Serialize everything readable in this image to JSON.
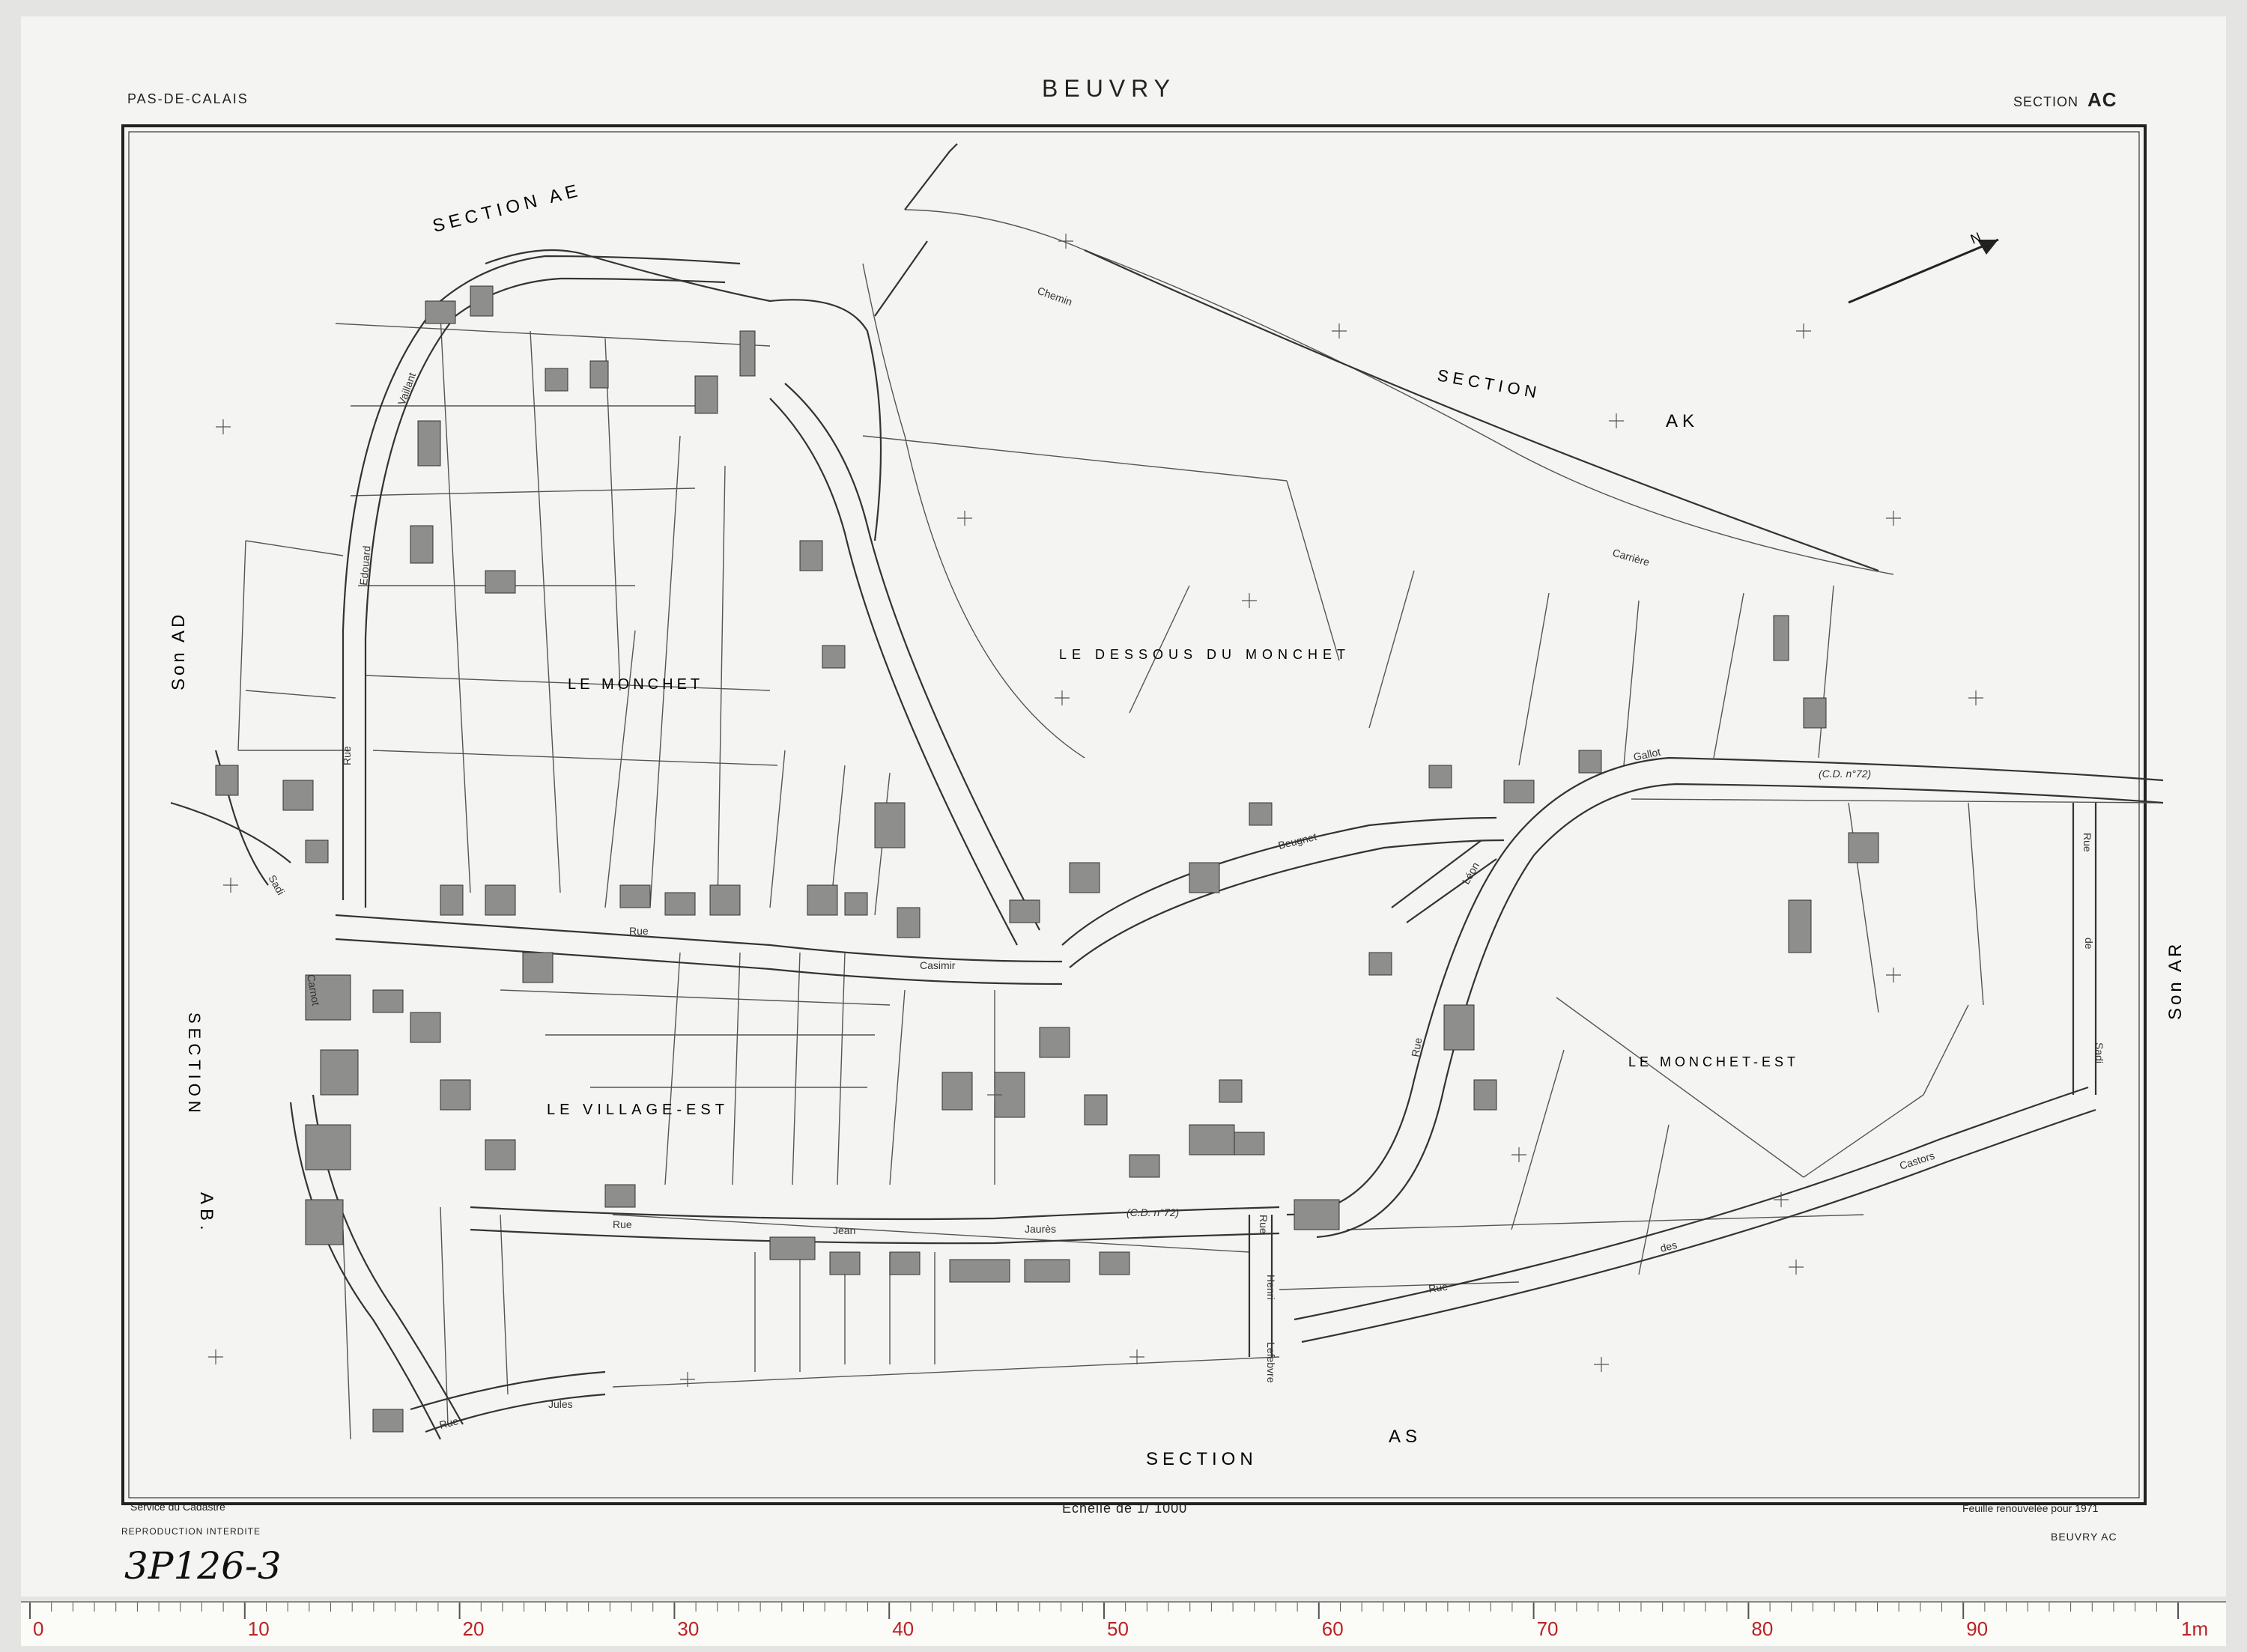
{
  "header": {
    "department": "PAS-DE-CALAIS",
    "commune": "BEUVRY",
    "section_word": "SECTION",
    "section_code": "AC"
  },
  "footer": {
    "service": "Service du Cadastre",
    "reproduction": "REPRODUCTION INTERDITE",
    "scale": "Echelle de 1/ 1000",
    "renewal": "Feuille renouvelée pour 1971",
    "sheet_ref": "BEUVRY AC",
    "archive_code": "3P126-3"
  },
  "map": {
    "neighbor_sections": {
      "ae": "SECTION AE",
      "ak_a": "SECTION",
      "ak_b": "AK",
      "ad": "Son AD",
      "ab_a": "SECTION",
      "ab_b": "AB.",
      "as_a": "SECTION",
      "as_b": "AS",
      "ar": "Son AR"
    },
    "localities": [
      "LE MONCHET",
      "LE DESSOUS DU MONCHET",
      "LE VILLAGE-EST",
      "LE MONCHET-EST"
    ],
    "road_labels": {
      "cd72_east": "(C.D. n°72)",
      "cd72_south": "(C.D. n°72)",
      "rue_casimir": "Casimir",
      "rue_jean_jaures_a": "Rue",
      "rue_jean_jaures_b": "Jean",
      "rue_jean_jaures_c": "Jaurès",
      "rue_north": "Rue",
      "rue_west": "Rue",
      "edouard": "Edouard",
      "vaillant": "Vaillant",
      "carriere": "Carrière",
      "chemin": "Chemin",
      "rue_des_castors_a": "Rue",
      "rue_des_castors_b": "des",
      "rue_des_castors_c": "Castors",
      "rue_jules": "Rue",
      "jules": "Jules",
      "rue_henri": "Rue",
      "henri": "Henri",
      "lefebvre": "Lefebvre",
      "gallot": "Gallot",
      "leon": "Léon",
      "beugnet": "Beugnet",
      "sadi": "Sadi",
      "carnot": "Carnot",
      "rue_sadi_east": "Rue",
      "sadi_east": "Sadi",
      "de": "de",
      "rue_leon": "Rue"
    },
    "north_label": "N"
  },
  "ruler": {
    "major_labels": [
      "0",
      "10",
      "20",
      "30",
      "40",
      "50",
      "60",
      "70",
      "80",
      "90",
      "1m"
    ]
  }
}
